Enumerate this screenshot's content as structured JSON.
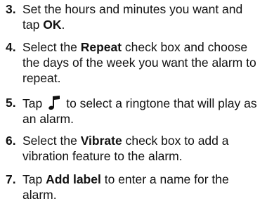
{
  "steps": [
    {
      "number": "3.",
      "text_a": "Set the hours and minutes you want and tap ",
      "bold_a": "OK",
      "text_b": "."
    },
    {
      "number": "4.",
      "text_a": "Select the ",
      "bold_a": "Repeat",
      "text_b": " check box and choose the days of the week you want the alarm to repeat."
    },
    {
      "number": "5.",
      "text_a": "Tap",
      "icon": "music-note-icon",
      "text_b": "to select a ringtone that will play as an alarm."
    },
    {
      "number": "6.",
      "text_a": "Select the ",
      "bold_a": "Vibrate",
      "text_b": " check box to add a vibration feature to the alarm."
    },
    {
      "number": "7.",
      "text_a": "Tap ",
      "bold_a": "Add label",
      "text_b": " to enter a name for the alarm."
    }
  ],
  "colors": {
    "text": "#111111",
    "background": "#ffffff"
  }
}
